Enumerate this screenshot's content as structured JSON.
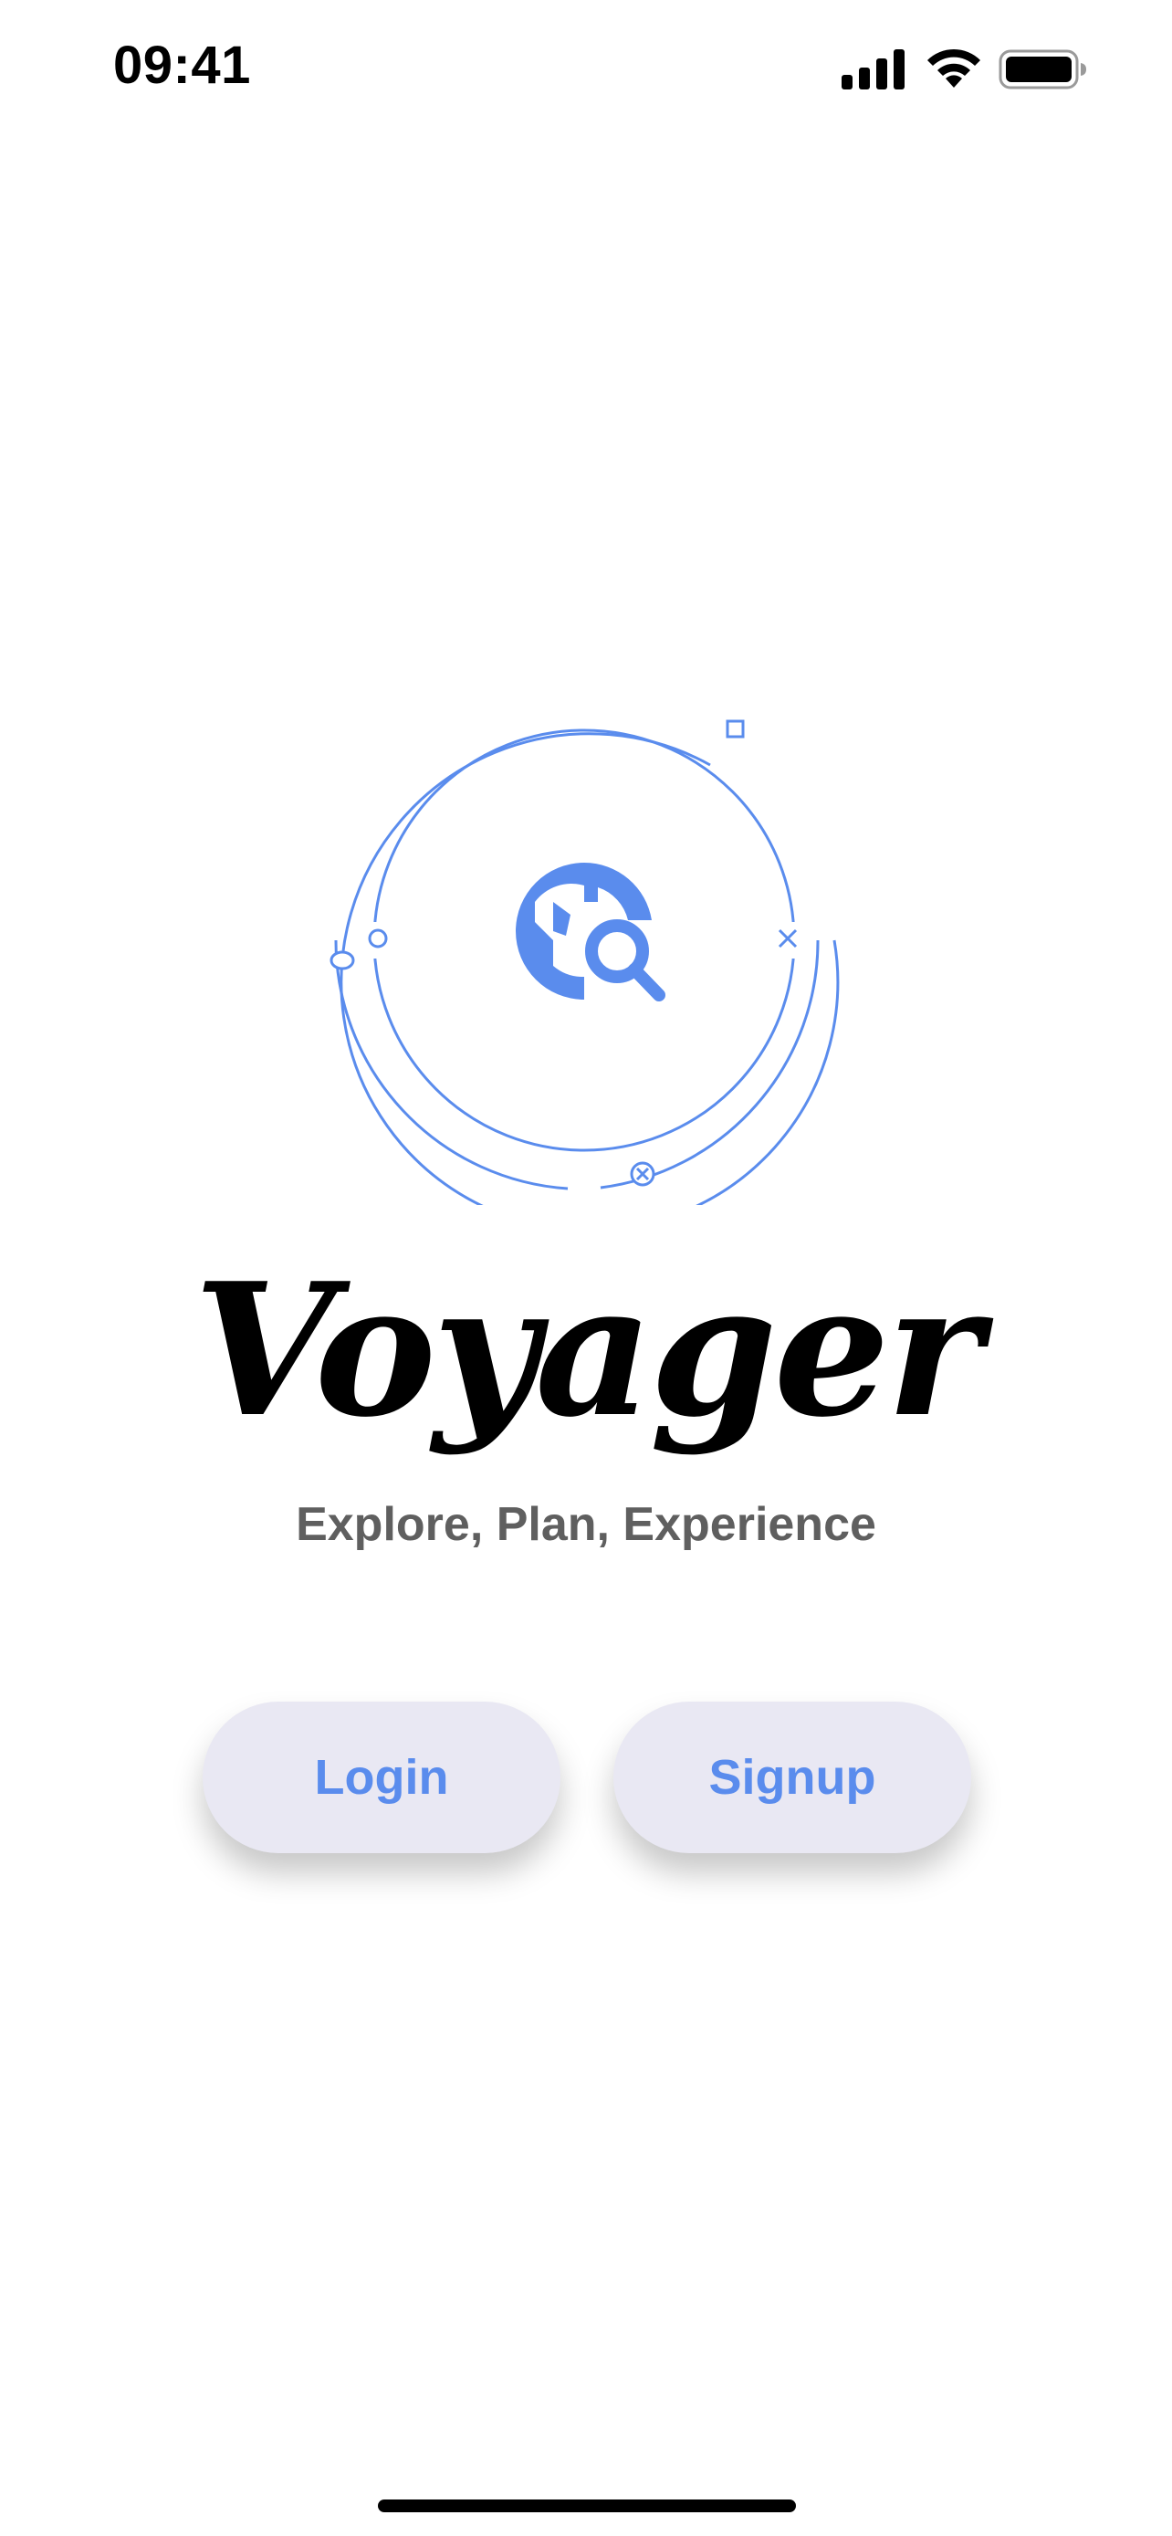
{
  "status_bar": {
    "time": "09:41",
    "icons": [
      "cellular-signal-icon",
      "wifi-icon",
      "battery-icon"
    ]
  },
  "logo": {
    "icon": "travel-explore-icon",
    "accent_color": "#5a8ced"
  },
  "app": {
    "title": "Voyager",
    "tagline": "Explore, Plan, Experience"
  },
  "actions": {
    "login_label": "Login",
    "signup_label": "Signup"
  },
  "colors": {
    "accent": "#5a8ced",
    "button_bg": "#e9e8f3",
    "tagline": "#5f5f5f"
  }
}
